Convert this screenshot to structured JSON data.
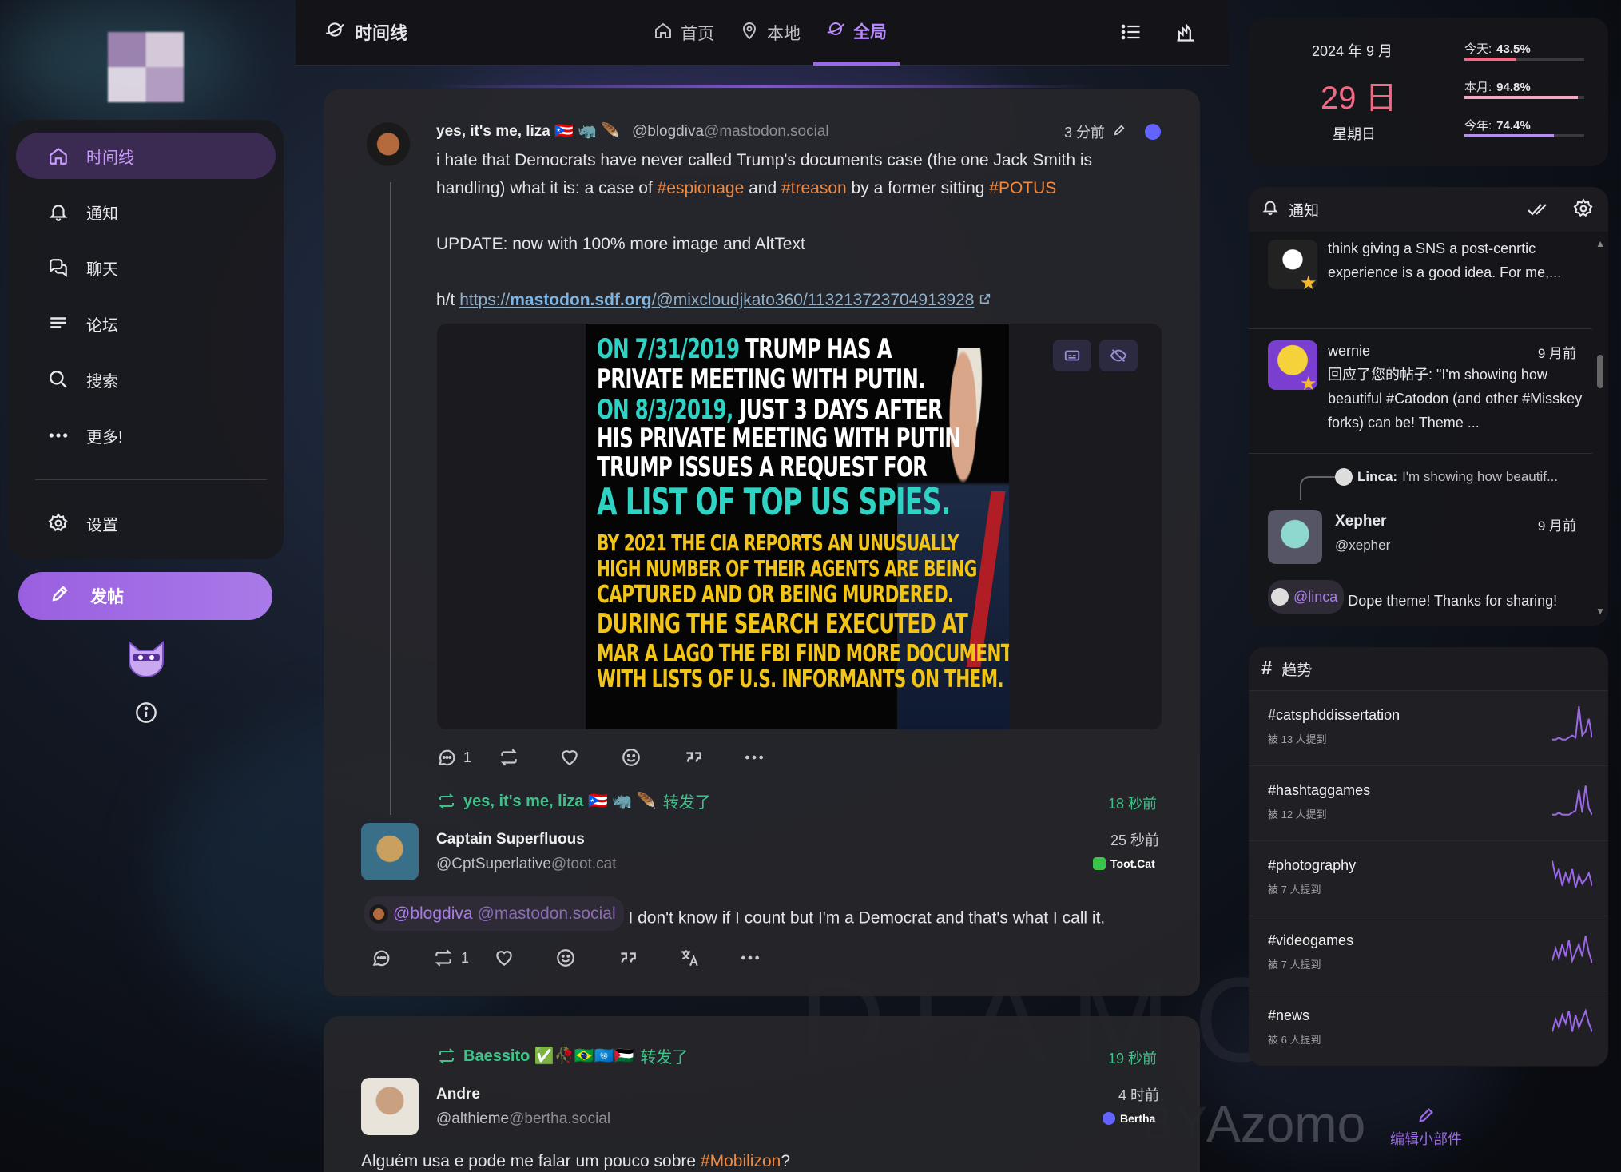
{
  "left_nav": {
    "items": [
      {
        "label": "时间线",
        "icon": "home-icon"
      },
      {
        "label": "通知",
        "icon": "bell-icon"
      },
      {
        "label": "聊天",
        "icon": "chat-icon"
      },
      {
        "label": "论坛",
        "icon": "forum-icon"
      },
      {
        "label": "搜索",
        "icon": "search-icon"
      },
      {
        "label": "更多!",
        "icon": "more-icon"
      }
    ],
    "settings_label": "设置",
    "post_button_label": "发帖"
  },
  "header": {
    "title": "时间线",
    "tabs": [
      {
        "label": "首页",
        "icon": "home-icon"
      },
      {
        "label": "本地",
        "icon": "pin-icon"
      },
      {
        "label": "全局",
        "icon": "globe-icon"
      }
    ],
    "active_tab": "全局"
  },
  "posts": {
    "p1": {
      "display_name": "yes, it's me, liza 🇵🇷 🦏 🪶",
      "user": "@blogdiva",
      "host": "@mastodon.social",
      "time": "3 分前",
      "text_1": "i hate that Democrats have never called Trump's documents case (the one Jack Smith is",
      "text_2a": "handling) what it is: a case of ",
      "tag_1": "#espionage",
      "text_2b": " and ",
      "tag_2": "#treason",
      "text_2c": " by a former sitting ",
      "tag_3": "#POTUS",
      "text_3": "UPDATE: now with 100% more image and AltText",
      "ht": "h/t ",
      "link_scheme": "https://",
      "link_host": "mastodon.sdf.org",
      "link_path": "/@mixcloudjkato360/113213723704913928",
      "image_lines": [
        {
          "a": "ON 7/31/2019 ",
          "b": "TRUMP HAS A"
        },
        {
          "a": "",
          "b": "PRIVATE MEETING WITH PUTIN."
        },
        {
          "a": "ON 8/3/2019, ",
          "b": "JUST 3 DAYS AFTER"
        },
        {
          "a": "",
          "b": "HIS PRIVATE MEETING WITH PUTIN"
        },
        {
          "a": "",
          "b": "TRUMP ISSUES A REQUEST FOR"
        },
        {
          "a": "A LIST OF TOP US SPIES.",
          "b": ""
        },
        {
          "a": "",
          "b": "BY 2021 THE CIA REPORTS AN UNUSUALLY"
        },
        {
          "a": "",
          "b": "HIGH NUMBER OF THEIR AGENTS ARE BEING"
        },
        {
          "a": "",
          "b": "CAPTURED AND OR BEING MURDERED."
        },
        {
          "a": "DURING THE SEARCH EXECUTED AT",
          "b": ""
        },
        {
          "a": "MAR A LAGO THE FBI FIND MORE DOCUMENTS",
          "b": ""
        },
        {
          "a": "WITH LISTS OF U.S. INFORMANTS ON THEM.",
          "b": ""
        }
      ],
      "reply_count": "1"
    },
    "p2": {
      "reblogger": "yes, it's me, liza 🇵🇷 🦏 🪶",
      "reblog_label": "转发了",
      "reblog_time": "18 秒前",
      "display_name": "Captain Superfluous",
      "user": "@CptSuperlative",
      "host": "@toot.cat",
      "time": "25 秒前",
      "instance": "Toot.Cat",
      "mention_user": "@blogdiva",
      "mention_host": "@mastodon.social",
      "text": " I don't know if I count but I'm a Democrat and that's what I call it.",
      "reblog_count": "1"
    },
    "p3": {
      "reblogger": "Baessito ✅🥀🇧🇷🇺🇳🇵🇸",
      "reblog_label": "转发了",
      "reblog_time": "19 秒前",
      "display_name": "Andre",
      "user": "@althieme",
      "host": "@bertha.social",
      "time": "4 时前",
      "instance": "Bertha",
      "text_a": "Alguém usa e pode me falar um pouco sobre ",
      "tag": "#Mobilizon",
      "text_b": "?"
    }
  },
  "calendar": {
    "year_month": "2024 年  9 月",
    "day": "29 日",
    "weekday": "星期日",
    "stats": [
      {
        "label": "今天:",
        "value": "43.5%",
        "fraction": 0.435,
        "color": "#f06a85"
      },
      {
        "label": "本月:",
        "value": "94.8%",
        "fraction": 0.948,
        "color": "#f3a6c0"
      },
      {
        "label": "今年:",
        "value": "74.4%",
        "fraction": 0.744,
        "color": "#b48ef0"
      }
    ]
  },
  "notifications": {
    "title": "通知",
    "n1_text": "think giving a SNS a post-cenrtic experience is a good idea.  For me,...",
    "n2_name": "wernie",
    "n2_time": "9 月前",
    "n2_text": "回应了您的帖子: \"I'm showing how beautiful #Catodon (and other #Misskey forks) can be!  Theme ...",
    "n3_quote_name": "Linca:",
    "n3_quote_text": " I'm showing how beautif...",
    "n3_name": "Xepher",
    "n3_handle": "@xepher",
    "n3_time": "9 月前",
    "n3_mention": "@linca",
    "n3_text": " Dope theme! Thanks for sharing!"
  },
  "trends": {
    "title": "趋势",
    "items": [
      {
        "tag": "#catsphddissertation",
        "count": "被 13 人提到"
      },
      {
        "tag": "#hashtaggames",
        "count": "被 12 人提到"
      },
      {
        "tag": "#photography",
        "count": "被 7 人提到"
      },
      {
        "tag": "#videogames",
        "count": "被 7 人提到"
      },
      {
        "tag": "#news",
        "count": "被 6 人提到"
      }
    ]
  },
  "edit_widgets_label": "编辑小部件",
  "watermark_1": "DIAMOND",
  "watermark_2": "BY Azomo",
  "colors": {
    "accent": "#9b68e8",
    "hashtag": "#f0883e",
    "boost": "#3fc28a",
    "date": "#f06a85"
  }
}
